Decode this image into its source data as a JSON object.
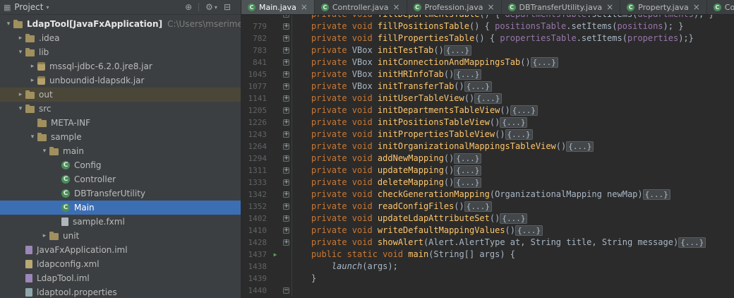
{
  "icons": {
    "panel": "▦",
    "dropdown": "▾",
    "locate": "⊕",
    "gear": "⚙",
    "hide": "⊟",
    "run": "▶",
    "close": "×",
    "expand": "▸",
    "collapse": "▾",
    "class_letter": "C",
    "fold_plus": "+",
    "fold_minus": "−"
  },
  "colors": {
    "panel_bg": "#3c3f41",
    "editor_bg": "#2b2b2b",
    "selection_blue": "#3c6eb4",
    "keyword": "#cc7832",
    "method_decl": "#ffc66b",
    "field": "#9876aa",
    "plain_text": "#a9b7c6",
    "line_number": "#606366",
    "class_icon_green": "#4a8d5b"
  },
  "project_panel": {
    "header": {
      "title": "Project"
    },
    "tree": [
      {
        "label": "LdapTool",
        "suffix": " [JavaFxApplication]",
        "path": "C:\\Users\\mserimer\\IdeaP",
        "depth": 0,
        "arrow": "down",
        "icon": "folder",
        "bold": true
      },
      {
        "label": ".idea",
        "depth": 1,
        "arrow": "right",
        "icon": "folder"
      },
      {
        "label": "lib",
        "depth": 1,
        "arrow": "down",
        "icon": "folder"
      },
      {
        "label": "mssql-jdbc-6.2.0.jre8.jar",
        "depth": 2,
        "arrow": "right",
        "icon": "jar"
      },
      {
        "label": "unboundid-ldapsdk.jar",
        "depth": 2,
        "arrow": "right",
        "icon": "jar"
      },
      {
        "label": "out",
        "depth": 1,
        "arrow": "right",
        "icon": "folder",
        "highlight": "hover"
      },
      {
        "label": "src",
        "depth": 1,
        "arrow": "down",
        "icon": "folder"
      },
      {
        "label": "META-INF",
        "depth": 2,
        "arrow": "none",
        "icon": "folder"
      },
      {
        "label": "sample",
        "depth": 2,
        "arrow": "down",
        "icon": "folder"
      },
      {
        "label": "main",
        "depth": 3,
        "arrow": "down",
        "icon": "folder"
      },
      {
        "label": "Config",
        "depth": 4,
        "arrow": "none",
        "icon": "class"
      },
      {
        "label": "Controller",
        "depth": 4,
        "arrow": "none",
        "icon": "class"
      },
      {
        "label": "DBTransferUtility",
        "depth": 4,
        "arrow": "none",
        "icon": "class"
      },
      {
        "label": "Main",
        "depth": 4,
        "arrow": "none",
        "icon": "class",
        "highlight": "selected"
      },
      {
        "label": "sample.fxml",
        "depth": 4,
        "arrow": "none",
        "icon": "file"
      },
      {
        "label": "unit",
        "depth": 3,
        "arrow": "right",
        "icon": "folder"
      },
      {
        "label": "JavaFxApplication.iml",
        "depth": 1,
        "arrow": "none",
        "icon": "iml"
      },
      {
        "label": "ldapconfig.xml",
        "depth": 1,
        "arrow": "none",
        "icon": "xml"
      },
      {
        "label": "LdapTool.iml",
        "depth": 1,
        "arrow": "none",
        "icon": "iml"
      },
      {
        "label": "ldaptool.properties",
        "depth": 1,
        "arrow": "none",
        "icon": "properties"
      }
    ]
  },
  "tabs": [
    {
      "label": "Main.java",
      "active": true
    },
    {
      "label": "Controller.java",
      "active": false
    },
    {
      "label": "Profession.java",
      "active": false
    },
    {
      "label": "DBTransferUtility.java",
      "active": false
    },
    {
      "label": "Property.java",
      "active": false
    },
    {
      "label": "Config.java",
      "active": false
    }
  ],
  "editor": {
    "lines": [
      {
        "num": "",
        "partial": true,
        "fold": "plus",
        "tokens": [
          [
            "kw",
            "private void "
          ],
          [
            "fn",
            "fillDepartmentsTable"
          ],
          [
            "pl",
            "() { "
          ],
          [
            "fld",
            "departmentsTable"
          ],
          [
            "pl",
            ".setItems("
          ],
          [
            "fld",
            "departments"
          ],
          [
            "pl",
            "); }"
          ]
        ]
      },
      {
        "num": "779",
        "fold": "plus",
        "tokens": [
          [
            "kw",
            "private void "
          ],
          [
            "fn",
            "fillPositionsTable"
          ],
          [
            "pl",
            "() { "
          ],
          [
            "fld",
            "positionsTable"
          ],
          [
            "pl",
            ".setItems("
          ],
          [
            "fld",
            "positions"
          ],
          [
            "pl",
            "); }"
          ]
        ]
      },
      {
        "num": "782",
        "fold": "plus",
        "tokens": [
          [
            "kw",
            "private void "
          ],
          [
            "fn",
            "fillPropertiesTable"
          ],
          [
            "pl",
            "() { "
          ],
          [
            "fld",
            "propertiesTable"
          ],
          [
            "pl",
            ".setItems("
          ],
          [
            "fld",
            "properties"
          ],
          [
            "pl",
            ");}"
          ]
        ]
      },
      {
        "num": "783",
        "fold": "plus",
        "tokens": [
          [
            "kw",
            "private "
          ],
          [
            "pl",
            "VBox "
          ],
          [
            "fn",
            "initTestTab"
          ],
          [
            "pl",
            "()"
          ],
          [
            "fold",
            "{...}"
          ]
        ]
      },
      {
        "num": "841",
        "fold": "plus",
        "tokens": [
          [
            "kw",
            "private "
          ],
          [
            "pl",
            "VBox "
          ],
          [
            "fn",
            "initConnectionAndMappingsTab"
          ],
          [
            "pl",
            "()"
          ],
          [
            "fold",
            "{...}"
          ]
        ]
      },
      {
        "num": "1045",
        "fold": "plus",
        "tokens": [
          [
            "kw",
            "private "
          ],
          [
            "pl",
            "VBox "
          ],
          [
            "fn",
            "initHRInfoTab"
          ],
          [
            "pl",
            "()"
          ],
          [
            "fold",
            "{...}"
          ]
        ]
      },
      {
        "num": "1077",
        "fold": "plus",
        "tokens": [
          [
            "kw",
            "private "
          ],
          [
            "pl",
            "VBox "
          ],
          [
            "fn",
            "initTransferTab"
          ],
          [
            "pl",
            "()"
          ],
          [
            "fold",
            "{...}"
          ]
        ]
      },
      {
        "num": "1141",
        "fold": "plus",
        "tokens": [
          [
            "kw",
            "private void "
          ],
          [
            "fn",
            "initUserTableView"
          ],
          [
            "pl",
            "()"
          ],
          [
            "fold",
            "{...}"
          ]
        ]
      },
      {
        "num": "1205",
        "fold": "plus",
        "tokens": [
          [
            "kw",
            "private void "
          ],
          [
            "fn",
            "initDepartmentsTableView"
          ],
          [
            "pl",
            "()"
          ],
          [
            "fold",
            "{...}"
          ]
        ]
      },
      {
        "num": "1226",
        "fold": "plus",
        "tokens": [
          [
            "kw",
            "private void "
          ],
          [
            "fn",
            "initPositionsTableView"
          ],
          [
            "pl",
            "()"
          ],
          [
            "fold",
            "{...}"
          ]
        ]
      },
      {
        "num": "1243",
        "fold": "plus",
        "tokens": [
          [
            "kw",
            "private void "
          ],
          [
            "fn",
            "initPropertiesTableView"
          ],
          [
            "pl",
            "()"
          ],
          [
            "fold",
            "{...}"
          ]
        ]
      },
      {
        "num": "1264",
        "fold": "plus",
        "tokens": [
          [
            "kw",
            "private void "
          ],
          [
            "fn",
            "initOrganizationalMappingsTableView"
          ],
          [
            "pl",
            "()"
          ],
          [
            "fold",
            "{...}"
          ]
        ]
      },
      {
        "num": "1294",
        "fold": "plus",
        "tokens": [
          [
            "kw",
            "private void "
          ],
          [
            "fn",
            "addNewMapping"
          ],
          [
            "pl",
            "()"
          ],
          [
            "fold",
            "{...}"
          ]
        ]
      },
      {
        "num": "1311",
        "fold": "plus",
        "tokens": [
          [
            "kw",
            "private void "
          ],
          [
            "fn",
            "updateMapping"
          ],
          [
            "pl",
            "()"
          ],
          [
            "fold",
            "{...}"
          ]
        ]
      },
      {
        "num": "1333",
        "fold": "plus",
        "tokens": [
          [
            "kw",
            "private void "
          ],
          [
            "fn",
            "deleteMapping"
          ],
          [
            "pl",
            "()"
          ],
          [
            "fold",
            "{...}"
          ]
        ]
      },
      {
        "num": "1342",
        "fold": "plus",
        "tokens": [
          [
            "kw",
            "private void "
          ],
          [
            "fn",
            "checkGenerationMapping"
          ],
          [
            "pl",
            "(OrganizationalMapping newMap)"
          ],
          [
            "fold",
            "{...}"
          ]
        ]
      },
      {
        "num": "1352",
        "fold": "plus",
        "tokens": [
          [
            "kw",
            "private void "
          ],
          [
            "fn",
            "readConfigFiles"
          ],
          [
            "pl",
            "()"
          ],
          [
            "fold",
            "{...}"
          ]
        ]
      },
      {
        "num": "1402",
        "fold": "plus",
        "tokens": [
          [
            "kw",
            "private void "
          ],
          [
            "fn",
            "updateLdapAttributeSet"
          ],
          [
            "pl",
            "()"
          ],
          [
            "fold",
            "{...}"
          ]
        ]
      },
      {
        "num": "1410",
        "fold": "plus",
        "tokens": [
          [
            "kw",
            "private void "
          ],
          [
            "fn",
            "writeDefaultMappingValues"
          ],
          [
            "pl",
            "()"
          ],
          [
            "fold",
            "{...}"
          ]
        ]
      },
      {
        "num": "1428",
        "fold": "plus",
        "tokens": [
          [
            "kw",
            "private void "
          ],
          [
            "fn",
            "showAlert"
          ],
          [
            "pl",
            "(Alert.AlertType at, String title, String message)"
          ],
          [
            "fold",
            "{...}"
          ]
        ]
      },
      {
        "num": "1437",
        "run": true,
        "tokens": [
          [
            "kw",
            "public static void "
          ],
          [
            "fn",
            "main"
          ],
          [
            "pl",
            "(String[] args) {"
          ]
        ]
      },
      {
        "num": "1438",
        "tokens": [
          [
            "pl",
            "    "
          ],
          [
            "it",
            "launch"
          ],
          [
            "pl",
            "(args);"
          ]
        ]
      },
      {
        "num": "1439",
        "tokens": [
          [
            "pl",
            "}"
          ]
        ]
      },
      {
        "num": "1440",
        "fold": "minus",
        "tokens": []
      }
    ]
  }
}
